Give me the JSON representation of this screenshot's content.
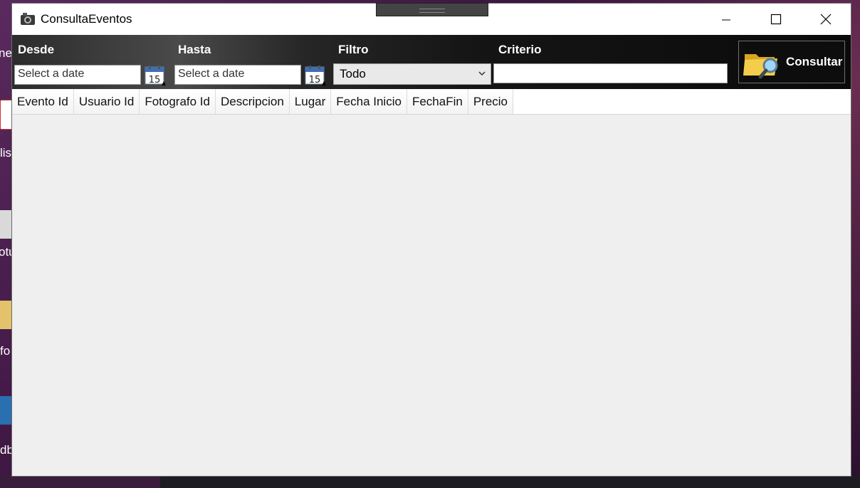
{
  "window": {
    "title": "ConsultaEventos"
  },
  "desktop": {
    "fragments": [
      "ner",
      "lis",
      "otu",
      "fo",
      "db"
    ]
  },
  "filters": {
    "desde_label": "Desde",
    "hasta_label": "Hasta",
    "filtro_label": "Filtro",
    "criterio_label": "Criterio",
    "desde_placeholder": "Select a date",
    "hasta_placeholder": "Select a date",
    "calendar_day": "15",
    "filtro_value": "Todo",
    "criterio_value": ""
  },
  "consult_button": {
    "label": "Consultar",
    "icon": "folder-search-icon"
  },
  "grid": {
    "columns": [
      "Evento Id",
      "Usuario Id",
      "Fotografo Id",
      "Descripcion",
      "Lugar",
      "Fecha Inicio",
      "FechaFin",
      "Precio"
    ],
    "rows": []
  }
}
